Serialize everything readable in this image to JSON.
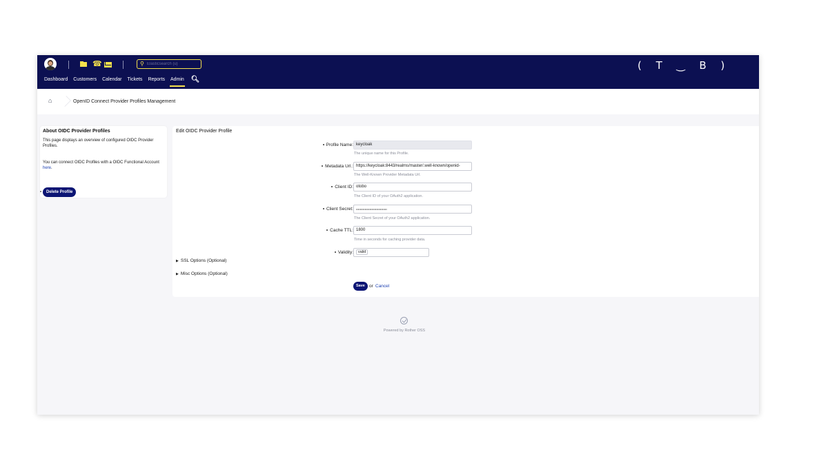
{
  "header": {
    "search_placeholder": "Elasticsearch (u)",
    "nav": [
      {
        "label": "Dashboard"
      },
      {
        "label": "Customers"
      },
      {
        "label": "Calendar"
      },
      {
        "label": "Tickets"
      },
      {
        "label": "Reports"
      },
      {
        "label": "Admin",
        "active": true
      }
    ],
    "logo": "( T ‿ B )",
    "accent_color": "#f7e24c",
    "bar_color": "#0c1052"
  },
  "breadcrumb": {
    "current": "OpenID Connect Provider Profiles Management"
  },
  "sidebar": {
    "title": "About OIDC Provider Profiles",
    "para1": "This page displays an overview of configured OIDC Provider Profiles.",
    "para2_prefix": "You can connect OIDC Profiles with a OIDC Functional Account",
    "para2_link": "here",
    "para2_suffix": ".",
    "delete_button": "Delete Profile"
  },
  "form": {
    "title": "Edit OIDC Provider Profile",
    "fields": [
      {
        "label": "Profile Name:",
        "value": "keycloak",
        "hint": "The unique name for this Profile."
      },
      {
        "label": "Metadata Url.:",
        "value": "https://keycloak:8443/realms/master/.well-known/openid-",
        "hint": "The Well-Known Provider Metadata Url."
      },
      {
        "label": "Client ID:",
        "value": "otobo",
        "hint": "The Client ID of your OAuth2 application."
      },
      {
        "label": "Client Secret:",
        "value": "••••••••••••••••••••••••••••••••",
        "hint": "The Client Secret of your OAuth2 application."
      },
      {
        "label": "Cache TTL:",
        "value": "1800",
        "hint": "Time in seconds for caching provider data."
      },
      {
        "label": "Validity:",
        "value": "valid"
      }
    ],
    "sections": [
      {
        "label": "SSL Options (Optional)"
      },
      {
        "label": "Misc Options (Optional)"
      }
    ],
    "save_label": "Save",
    "or_text": "or",
    "cancel_label": "Cancel"
  },
  "footer": {
    "text": "Powered by Rother OSS"
  }
}
